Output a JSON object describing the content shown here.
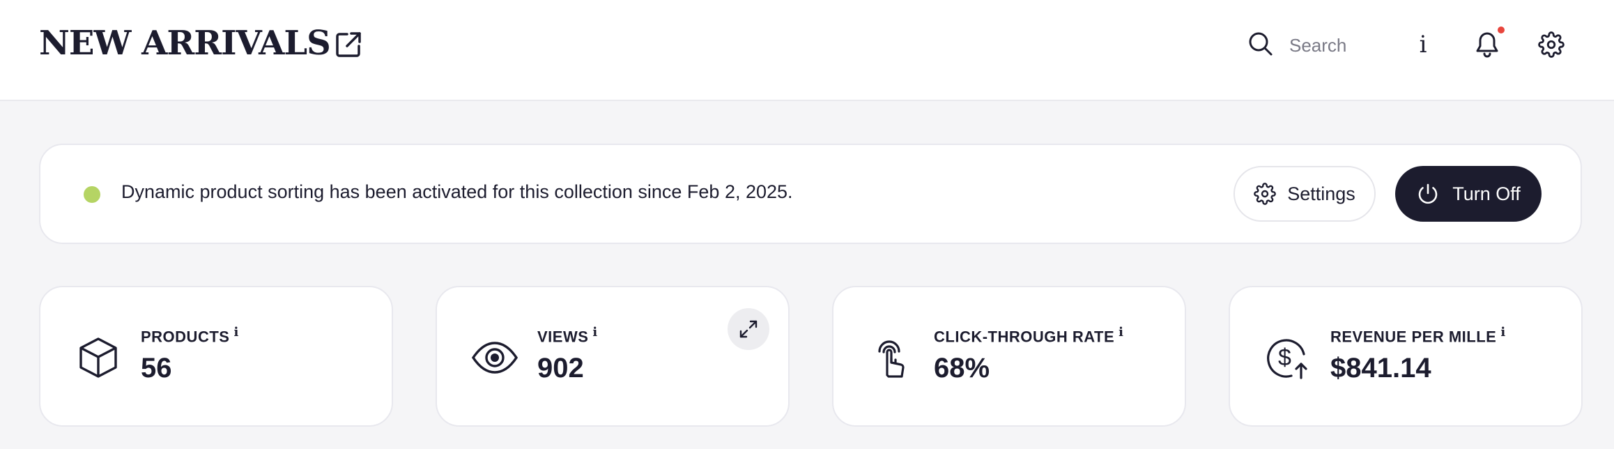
{
  "header": {
    "title": "NEW ARRIVALS",
    "search_placeholder": "Search",
    "info_glyph": "i",
    "icons": [
      "external-link-icon",
      "search-icon",
      "info-icon",
      "bell-icon",
      "gear-icon"
    ],
    "has_notification": true
  },
  "banner": {
    "message": "Dynamic product sorting has been activated for this collection since Feb 2, 2025.",
    "status_color": "#b5d464",
    "settings_label": "Settings",
    "turn_off_label": "Turn Off"
  },
  "metrics": [
    {
      "label": "PRODUCTS",
      "info": "i",
      "value": "56",
      "icon": "box-icon"
    },
    {
      "label": "VIEWS",
      "info": "i",
      "value": "902",
      "icon": "eye-icon"
    },
    {
      "label": "CLICK-THROUGH RATE",
      "info": "i",
      "value": "68%",
      "icon": "pointer-tap-icon"
    },
    {
      "label": "REVENUE PER MILLE",
      "info": "i",
      "value": "$841.14",
      "icon": "dollar-arrow-icon"
    }
  ],
  "colors": {
    "primary": "#1c1c2e",
    "background": "#f5f5f7",
    "notification": "#e8453c",
    "status": "#b5d464"
  }
}
